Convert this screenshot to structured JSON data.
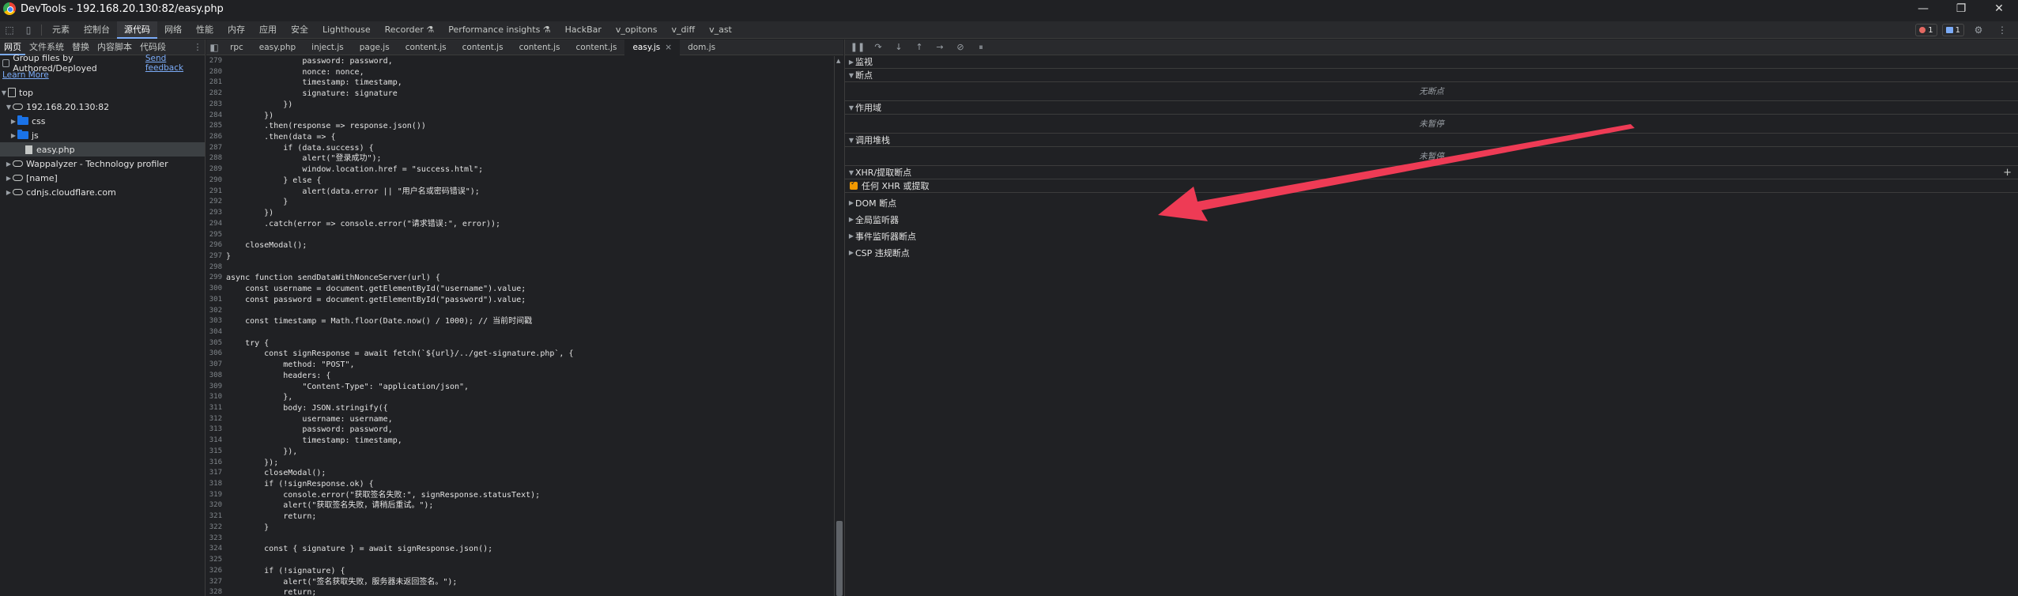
{
  "window": {
    "title": "DevTools - 192.168.20.130:82/easy.php",
    "minimize": "—",
    "maximize": "❐",
    "close": "✕"
  },
  "main_tabs": [
    "元素",
    "控制台",
    "源代码",
    "网络",
    "性能",
    "内存",
    "应用",
    "安全",
    "Lighthouse",
    "Recorder ⚗",
    "Performance insights ⚗",
    "HackBar",
    "v_opitons",
    "v_diff",
    "v_ast"
  ],
  "main_tabs_active_index": 2,
  "status": {
    "errors": "1",
    "messages": "1"
  },
  "navigator": {
    "tabs": [
      "网页",
      "文件系统",
      "替换",
      "内容脚本",
      "代码段"
    ],
    "active_index": 0,
    "group_label": "Group files by Authored/Deployed",
    "send_feedback": "Send feedback",
    "learn_more": "Learn More",
    "tree": {
      "top": "top",
      "host": "192.168.20.130:82",
      "css": "css",
      "js": "js",
      "file": "easy.php",
      "wappalyzer": "Wappalyzer - Technology profiler",
      "name": "[name]",
      "cdn": "cdnjs.cloudflare.com"
    }
  },
  "file_tabs": [
    "rpc",
    "easy.php",
    "inject.js",
    "page.js",
    "content.js",
    "content.js",
    "content.js",
    "content.js",
    "easy.js",
    "dom.js"
  ],
  "file_tabs_active_index": 8,
  "code_lines": [
    {
      "n": "279",
      "t": "                password: password,"
    },
    {
      "n": "280",
      "t": "                nonce: nonce,"
    },
    {
      "n": "281",
      "t": "                timestamp: timestamp,"
    },
    {
      "n": "282",
      "t": "                signature: signature"
    },
    {
      "n": "283",
      "t": "            })"
    },
    {
      "n": "284",
      "t": "        })"
    },
    {
      "n": "285",
      "t": "        .then(response => response.json())"
    },
    {
      "n": "286",
      "t": "        .then(data => {"
    },
    {
      "n": "287",
      "t": "            if (data.success) {"
    },
    {
      "n": "288",
      "t": "                alert(\"登录成功\");"
    },
    {
      "n": "289",
      "t": "                window.location.href = \"success.html\";"
    },
    {
      "n": "290",
      "t": "            } else {"
    },
    {
      "n": "291",
      "t": "                alert(data.error || \"用户名或密码错误\");"
    },
    {
      "n": "292",
      "t": "            }"
    },
    {
      "n": "293",
      "t": "        })"
    },
    {
      "n": "294",
      "t": "        .catch(error => console.error(\"请求错误:\", error));"
    },
    {
      "n": "295",
      "t": ""
    },
    {
      "n": "296",
      "t": "    closeModal();"
    },
    {
      "n": "297",
      "t": "}"
    },
    {
      "n": "298",
      "t": ""
    },
    {
      "n": "299",
      "t": "async function sendDataWithNonceServer(url) {"
    },
    {
      "n": "300",
      "t": "    const username = document.getElementById(\"username\").value;"
    },
    {
      "n": "301",
      "t": "    const password = document.getElementById(\"password\").value;"
    },
    {
      "n": "302",
      "t": ""
    },
    {
      "n": "303",
      "t": "    const timestamp = Math.floor(Date.now() / 1000); // 当前时间戳"
    },
    {
      "n": "304",
      "t": ""
    },
    {
      "n": "305",
      "t": "    try {"
    },
    {
      "n": "306",
      "t": "        const signResponse = await fetch(`${url}/../get-signature.php`, {"
    },
    {
      "n": "307",
      "t": "            method: \"POST\","
    },
    {
      "n": "308",
      "t": "            headers: {"
    },
    {
      "n": "309",
      "t": "                \"Content-Type\": \"application/json\","
    },
    {
      "n": "310",
      "t": "            },"
    },
    {
      "n": "311",
      "t": "            body: JSON.stringify({"
    },
    {
      "n": "312",
      "t": "                username: username,"
    },
    {
      "n": "313",
      "t": "                password: password,"
    },
    {
      "n": "314",
      "t": "                timestamp: timestamp,"
    },
    {
      "n": "315",
      "t": "            }),"
    },
    {
      "n": "316",
      "t": "        });"
    },
    {
      "n": "317",
      "t": "        closeModal();"
    },
    {
      "n": "318",
      "t": "        if (!signResponse.ok) {"
    },
    {
      "n": "319",
      "t": "            console.error(\"获取签名失败:\", signResponse.statusText);"
    },
    {
      "n": "320",
      "t": "            alert(\"获取签名失败，请稍后重试。\");"
    },
    {
      "n": "321",
      "t": "            return;"
    },
    {
      "n": "322",
      "t": "        }"
    },
    {
      "n": "323",
      "t": ""
    },
    {
      "n": "324",
      "t": "        const { signature } = await signResponse.json();"
    },
    {
      "n": "325",
      "t": ""
    },
    {
      "n": "326",
      "t": "        if (!signature) {"
    },
    {
      "n": "327",
      "t": "            alert(\"签名获取失败，服务器未返回签名。\");"
    },
    {
      "n": "328",
      "t": "            return;"
    }
  ],
  "debugger": {
    "watch": "监视",
    "breakpoints": "断点",
    "no_breakpoints": "无断点",
    "scope": "作用域",
    "not_paused": "未暂停",
    "callstack": "调用堆栈",
    "not_paused_2": "未暂停",
    "xhr": "XHR/提取断点",
    "xhr_any": "任何 XHR 或提取",
    "dom": "DOM 断点",
    "global": "全局监听器",
    "event": "事件监听器断点",
    "csp": "CSP 违规断点"
  },
  "colors": {
    "accent": "#7cacf8",
    "arrow": "#ee3b55",
    "checkbox": "#f29900",
    "folder": "#1a73e8"
  }
}
